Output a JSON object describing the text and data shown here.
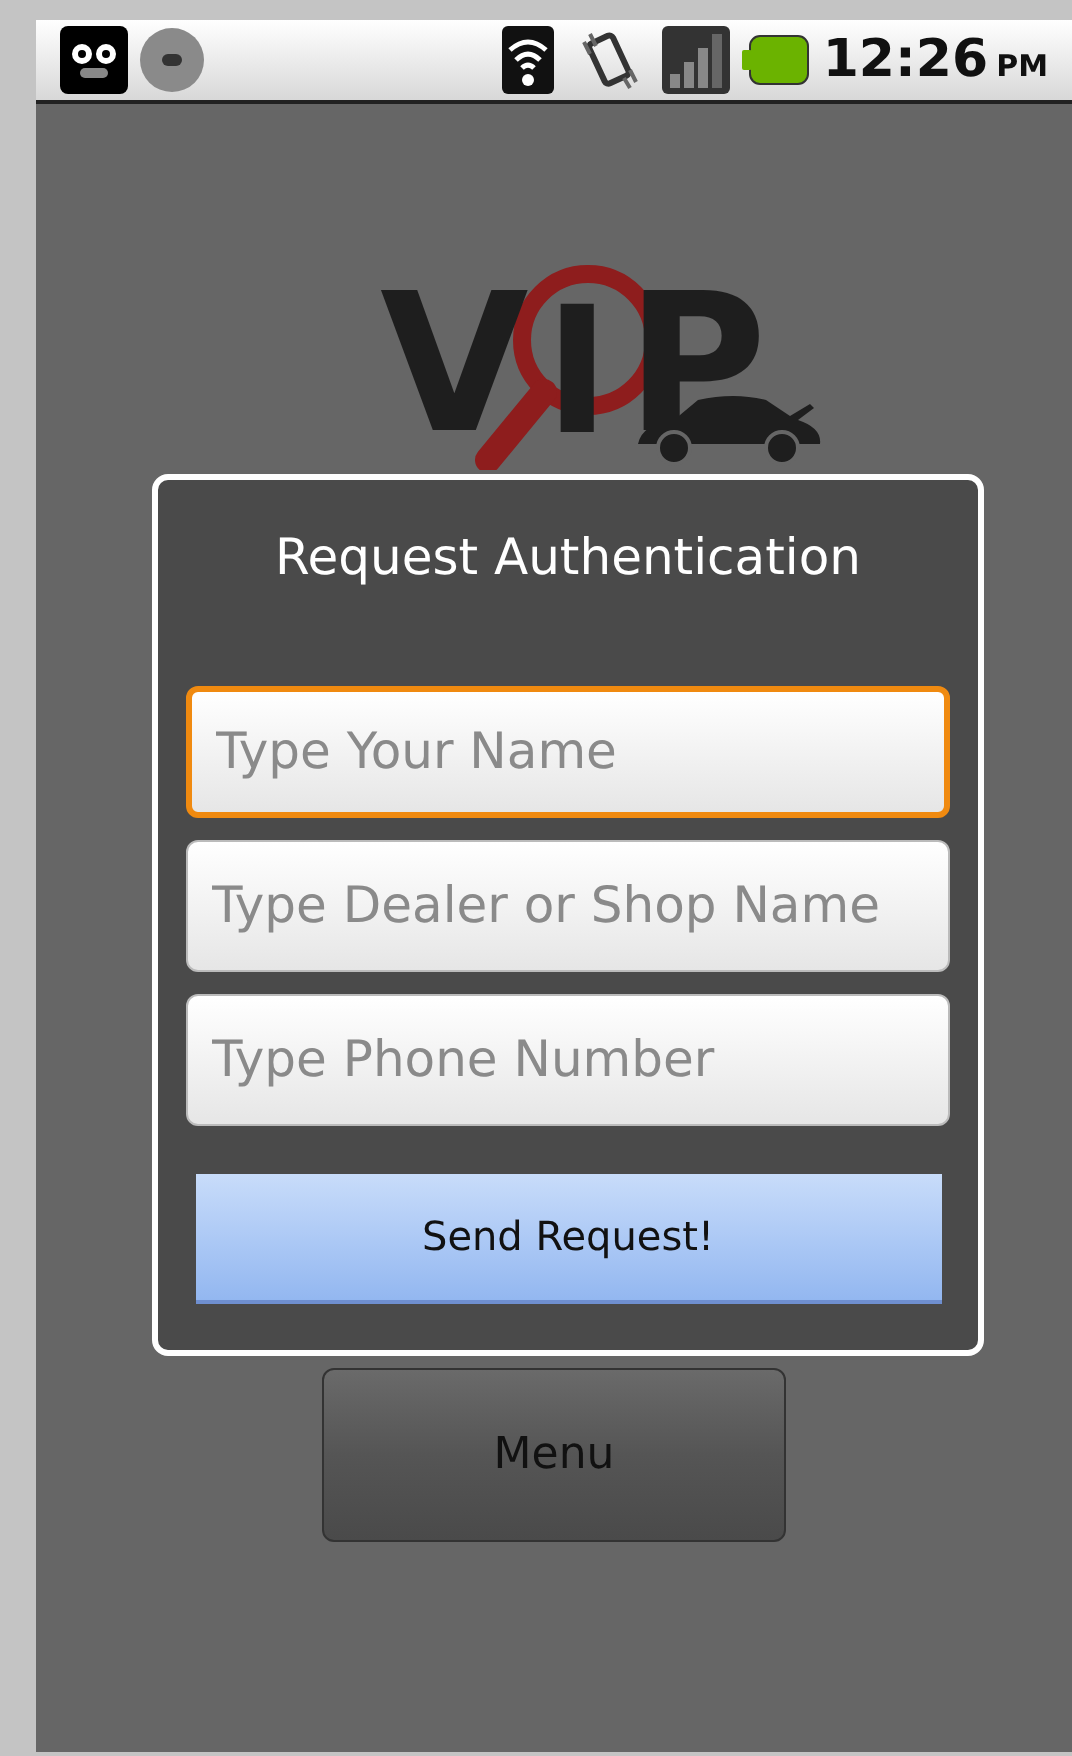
{
  "status_bar": {
    "time": "12:26",
    "period": "PM"
  },
  "logo": {
    "letters": [
      "V",
      "I",
      "P"
    ]
  },
  "dialog": {
    "title": "Request Authentication",
    "fields": [
      {
        "placeholder": "Type Your Name",
        "focused": true
      },
      {
        "placeholder": "Type Dealer or Shop Name",
        "focused": false
      },
      {
        "placeholder": "Type Phone Number",
        "focused": false
      }
    ],
    "submit": "Send Request!"
  },
  "buttons": [
    "Menu"
  ]
}
